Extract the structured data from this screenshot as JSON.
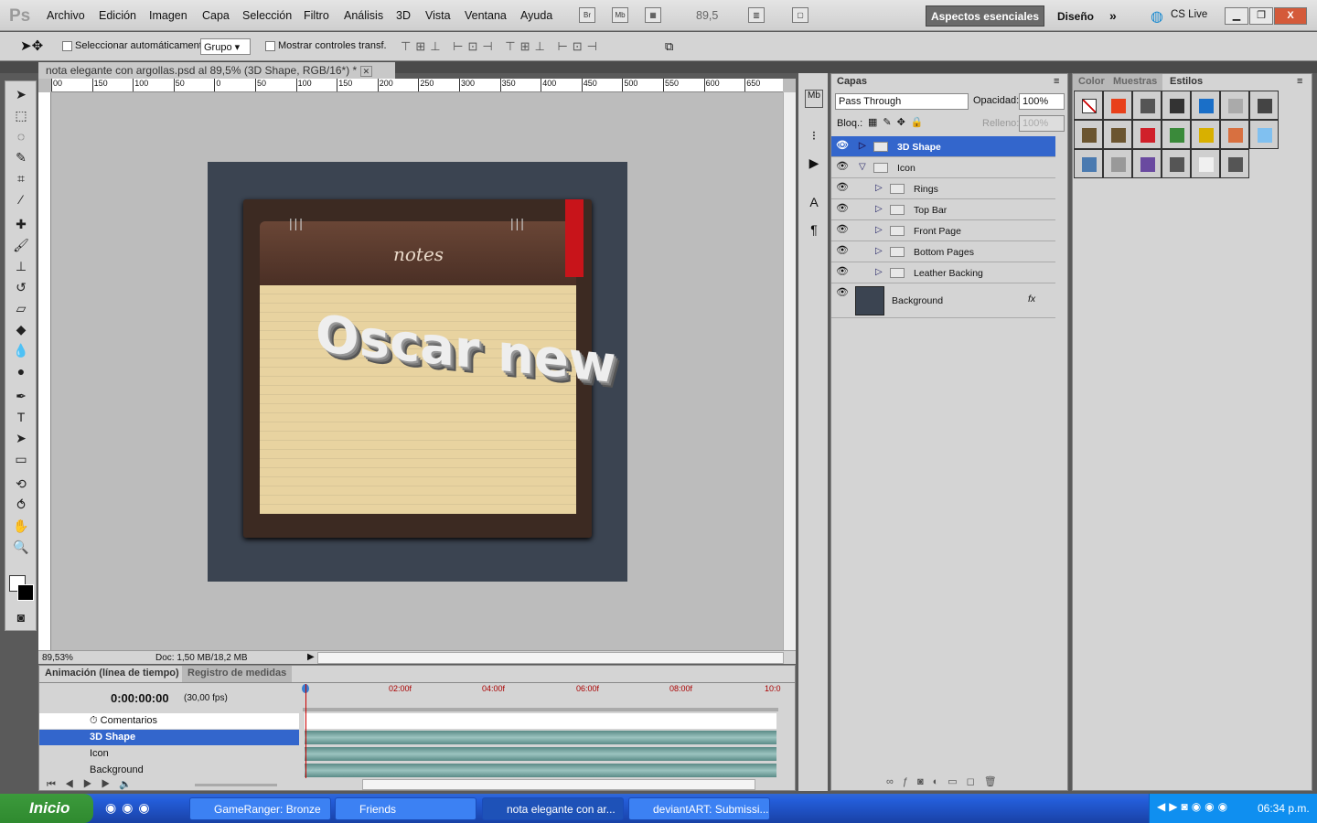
{
  "app": {
    "logo": "Ps",
    "menu": [
      "Archivo",
      "Edición",
      "Imagen",
      "Capa",
      "Selección",
      "Filtro",
      "Análisis",
      "3D",
      "Vista",
      "Ventana",
      "Ayuda"
    ],
    "bridge": "Br",
    "minibridge": "Mb",
    "zoom": "89,5",
    "workspace": "Aspectos esenciales",
    "design": "Diseño",
    "cslive": "CS Live"
  },
  "options": {
    "auto_select_label": "Seleccionar automáticamente:",
    "auto_select_value": "Grupo",
    "show_transform": "Mostrar controles transf."
  },
  "document": {
    "tab_title": "nota elegante con argollas.psd al 89,5% (3D Shape, RGB/16*) *",
    "ruler": [
      "00",
      "150",
      "100",
      "50",
      "0",
      "50",
      "100",
      "150",
      "200",
      "250",
      "300",
      "350",
      "400",
      "450",
      "500",
      "550",
      "600",
      "650"
    ],
    "art_heading": "notes",
    "art_text": "Oscar new",
    "zoom": "89,53%",
    "doc_size": "Doc: 1,50 MB/18,2 MB"
  },
  "timeline": {
    "tabs": [
      "Animación (línea de tiempo)",
      "Registro de medidas"
    ],
    "timecode": "0:00:00:00",
    "fps": "(30,00 fps)",
    "ticks": [
      "02:00f",
      "04:00f",
      "06:00f",
      "08:00f",
      "10:0"
    ],
    "rows": [
      "Comentarios",
      "3D Shape",
      "Icon",
      "Background"
    ]
  },
  "layers": {
    "tab": "Capas",
    "blend": "Pass Through",
    "opacity_label": "Opacidad:",
    "opacity": "100%",
    "lock_label": "Bloq.:",
    "fill_label": "Relleno:",
    "fill": "100%",
    "items": [
      {
        "name": "3D Shape",
        "selected": true
      },
      {
        "name": "Icon"
      },
      {
        "name": "Rings"
      },
      {
        "name": "Top Bar"
      },
      {
        "name": "Front Page"
      },
      {
        "name": "Bottom Pages"
      },
      {
        "name": "Leather Backing"
      },
      {
        "name": "Background"
      }
    ],
    "fx": "fx"
  },
  "styles": {
    "tabs": [
      "Color",
      "Muestras",
      "Estilos"
    ],
    "colors": [
      "none",
      "#e8401a",
      "#555555",
      "#333333",
      "#1a6fc8",
      "#aaaaaa",
      "#444444",
      "#6b5530",
      "#6b5530",
      "#d0202a",
      "#3a8a3a",
      "#d8b000",
      "#d87040",
      "#80c0f0",
      "#4a7ab0",
      "#999999",
      "#6a4aa0",
      "#555555",
      "#f0f0f0",
      "#555555"
    ]
  },
  "taskbar": {
    "start": "Inicio",
    "tasks": [
      "GameRanger: Bronze",
      "Friends",
      "nota elegante con ar...",
      "deviantART: Submissi..."
    ],
    "clock": "06:34 p.m."
  }
}
